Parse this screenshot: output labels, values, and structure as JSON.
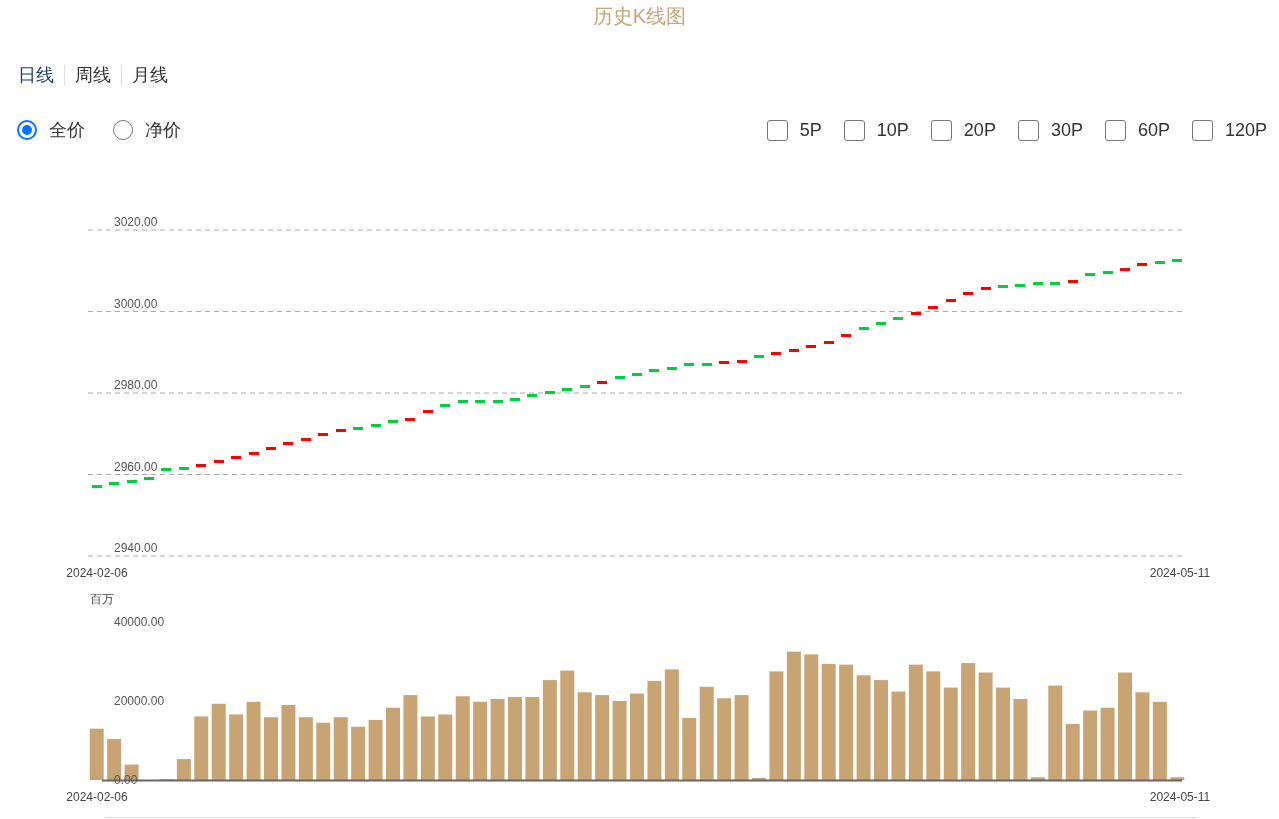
{
  "title": "历史K线图",
  "tabs": [
    {
      "label": "日线",
      "selected": true
    },
    {
      "label": "周线",
      "selected": false
    },
    {
      "label": "月线",
      "selected": false
    }
  ],
  "price_types": [
    {
      "label": "全价",
      "selected": true
    },
    {
      "label": "净价",
      "selected": false
    }
  ],
  "averages": [
    {
      "label": "5P",
      "checked": false
    },
    {
      "label": "10P",
      "checked": false
    },
    {
      "label": "20P",
      "checked": false
    },
    {
      "label": "30P",
      "checked": false
    },
    {
      "label": "60P",
      "checked": false
    },
    {
      "label": "120P",
      "checked": false
    }
  ],
  "price_chart": {
    "x_labels": [
      "2024-02-06",
      "2024-05-11"
    ],
    "chart_data": {
      "type": "scatter",
      "grid": true,
      "ylim": [
        2940,
        3020
      ],
      "yticks": [
        {
          "value": 3020,
          "label": "3020.00"
        },
        {
          "value": 3000,
          "label": "3000.00"
        },
        {
          "value": 2980,
          "label": "2980.00"
        },
        {
          "value": 2960,
          "label": "2960.00"
        },
        {
          "value": 2940,
          "label": "2940.00"
        }
      ],
      "series": [
        {
          "color": "#ff0000",
          "values": [
            null,
            null,
            null,
            null,
            null,
            null,
            2962.1,
            2963.2,
            2964.1,
            2965.2,
            2966.5,
            2967.6,
            2968.7,
            2969.8,
            2970.9,
            null,
            null,
            null,
            2973.6,
            2975.4,
            null,
            null,
            null,
            null,
            null,
            null,
            null,
            null,
            null,
            2982.5,
            null,
            null,
            null,
            null,
            null,
            null,
            2987.4,
            2987.8,
            null,
            2989.7,
            2990.4,
            2991.4,
            2992.5,
            2994.0,
            null,
            null,
            null,
            2999.4,
            3000.9,
            3002.6,
            3004.3,
            3005.6,
            null,
            null,
            null,
            null,
            3007.4,
            null,
            null,
            3010.4,
            3011.5,
            null,
            null
          ]
        },
        {
          "color": "#00d040",
          "values": [
            2957.0,
            2957.7,
            2958.4,
            2959.1,
            2961.2,
            2961.4,
            null,
            null,
            null,
            null,
            null,
            null,
            null,
            null,
            null,
            2971.3,
            2972.1,
            2973.0,
            null,
            null,
            2976.9,
            2977.8,
            2977.8,
            2977.9,
            2978.4,
            2979.3,
            2980.1,
            2980.8,
            2981.6,
            null,
            2983.9,
            2984.6,
            2985.4,
            2985.9,
            2986.9,
            2987.1,
            null,
            null,
            2988.9,
            null,
            null,
            null,
            null,
            null,
            2995.8,
            2997.0,
            2998.2,
            null,
            null,
            null,
            null,
            null,
            3006.1,
            3006.4,
            3006.9,
            3006.8,
            null,
            3009.1,
            3009.6,
            null,
            null,
            3012.1,
            3012.4
          ]
        }
      ]
    }
  },
  "volume_chart": {
    "x_labels": [
      "2024-02-06",
      "2024-05-11"
    ],
    "chart_data": {
      "type": "bar",
      "ylabel": "百万",
      "ylim": [
        0,
        40000
      ],
      "yticks": [
        {
          "value": 40000,
          "label": "40000.00"
        },
        {
          "value": 20000,
          "label": "20000.00"
        },
        {
          "value": 0,
          "label": "0.00"
        }
      ],
      "series": [
        {
          "color": "#c8a474",
          "values": [
            13000,
            10400,
            3900,
            0,
            200,
            5300,
            16100,
            19300,
            16600,
            19800,
            15900,
            19000,
            15900,
            14500,
            15900,
            13500,
            15200,
            18300,
            21500,
            16100,
            16600,
            21200,
            19800,
            20500,
            21000,
            21000,
            25300,
            27700,
            22200,
            21500,
            20000,
            21900,
            25100,
            28000,
            15700,
            23600,
            20700,
            21500,
            500,
            27500,
            32500,
            31800,
            29400,
            29200,
            26500,
            25300,
            22400,
            29200,
            27500,
            23400,
            29600,
            27200,
            23400,
            20500,
            700,
            23900,
            14200,
            17600,
            18300,
            27200,
            22200,
            19800,
            700
          ]
        }
      ]
    }
  }
}
